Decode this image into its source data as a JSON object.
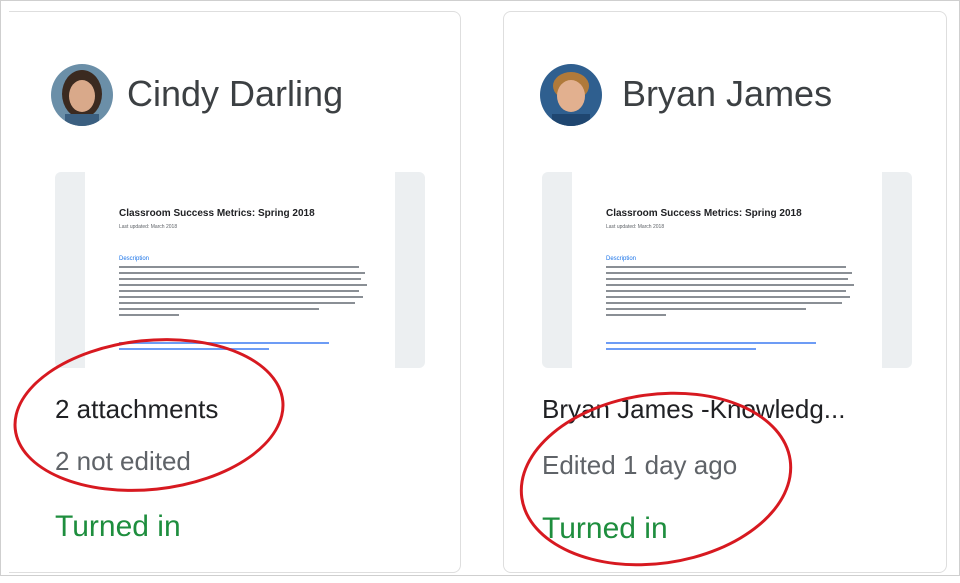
{
  "students": [
    {
      "name": "Cindy Darling",
      "avatar_icon": "student-photo-icon",
      "attachment_doc": {
        "title": "Classroom Success Metrics: Spring 2018",
        "subtitle": "Last updated: March 2018",
        "heading": "Description"
      },
      "line1": "2 attachments",
      "line2": "2 not edited",
      "status": "Turned in"
    },
    {
      "name": "Bryan James",
      "avatar_icon": "student-photo-icon",
      "attachment_doc": {
        "title": "Classroom Success Metrics: Spring 2018",
        "subtitle": "Last updated: March 2018",
        "heading": "Description"
      },
      "line1": "Bryan James -Knowledg...",
      "line2": "Edited 1 day ago",
      "status": "Turned in"
    }
  ],
  "colors": {
    "turned_in": "#1e8e3e",
    "annotation_circle": "#d71920"
  }
}
